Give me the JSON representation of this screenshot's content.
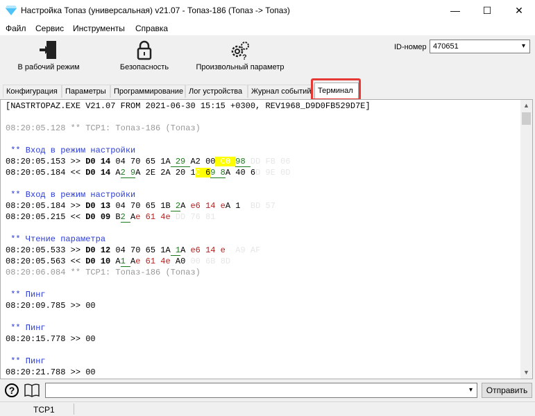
{
  "window": {
    "title": "Настройка Топаз (универсальная) v21.07 - Топаз-186 (Топаз -> Топаз)",
    "controls": {
      "minimize": "—",
      "maximize": "☐",
      "close": "✕"
    }
  },
  "menu": [
    "Файл",
    "Сервис",
    "Инструменты",
    "Справка"
  ],
  "toolbar": {
    "work_mode": "В рабочий режим",
    "security": "Безопасность",
    "custom_param": "Произвольный параметр",
    "id_label": "ID-номер",
    "id_value": "470651"
  },
  "tabs": [
    "Конфигурация",
    "Параметры",
    "Программирование",
    "Лог устройства",
    "Журнал событий",
    "Терминал"
  ],
  "terminal": {
    "header": "[NASTRTOPAZ.EXE V21.07 FROM 2021-06-30 15:15 +0300, REV1968_D9D0FB529D7E]",
    "tcp1_a": "08:20:05.128 ** TCP1: Топаз-186 (Топаз)",
    "enter_setup": " ** Вход в режим настройки",
    "read_param": " ** Чтение параметра",
    "ping": " ** Пинг",
    "tcp1_b": "08:20:06.084 ** TCP1: Топаз-186 (Топаз)",
    "t1": "08:20:05.153 >> ",
    "t2": "08:20:05.184 << ",
    "t3": "08:20:05.184 >> ",
    "t4": "08:20:05.215 << ",
    "t5": "08:20:05.533 >> ",
    "t6": "08:20:05.563 << ",
    "p1": "08:20:09.785 >> 00",
    "p2": "08:20:15.778 >> 00",
    "p3": "08:20:21.788 >> 00"
  },
  "bottom": {
    "send": "Отправить",
    "help": "?"
  },
  "status": {
    "connection": "TCP1"
  }
}
